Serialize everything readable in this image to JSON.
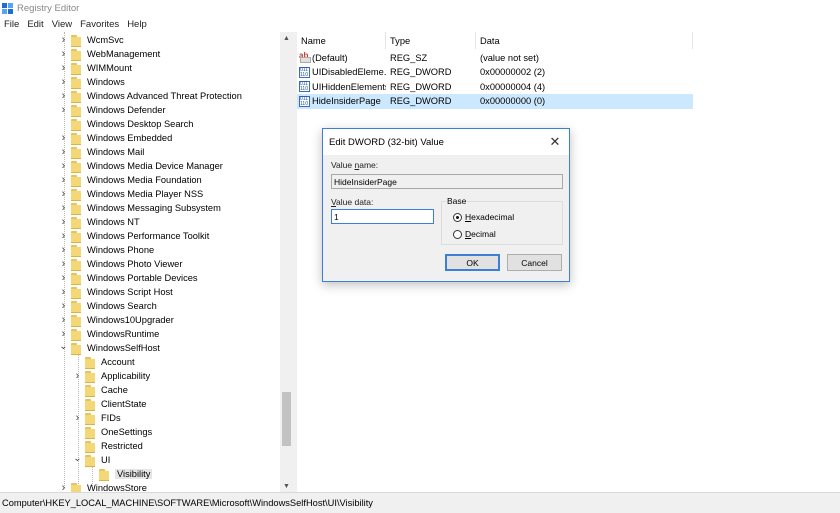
{
  "window": {
    "title": "Registry Editor",
    "icon": "registry-icon"
  },
  "menu": [
    "File",
    "Edit",
    "View",
    "Favorites",
    "Help"
  ],
  "tree": [
    {
      "label": "WcmSvc",
      "level": 0,
      "expander": "collapsed"
    },
    {
      "label": "WebManagement",
      "level": 0,
      "expander": "collapsed"
    },
    {
      "label": "WIMMount",
      "level": 0,
      "expander": "collapsed"
    },
    {
      "label": "Windows",
      "level": 0,
      "expander": "collapsed"
    },
    {
      "label": "Windows Advanced Threat Protection",
      "level": 0,
      "expander": "collapsed"
    },
    {
      "label": "Windows Defender",
      "level": 0,
      "expander": "collapsed"
    },
    {
      "label": "Windows Desktop Search",
      "level": 0,
      "expander": "none"
    },
    {
      "label": "Windows Embedded",
      "level": 0,
      "expander": "collapsed"
    },
    {
      "label": "Windows Mail",
      "level": 0,
      "expander": "collapsed"
    },
    {
      "label": "Windows Media Device Manager",
      "level": 0,
      "expander": "collapsed"
    },
    {
      "label": "Windows Media Foundation",
      "level": 0,
      "expander": "collapsed"
    },
    {
      "label": "Windows Media Player NSS",
      "level": 0,
      "expander": "collapsed"
    },
    {
      "label": "Windows Messaging Subsystem",
      "level": 0,
      "expander": "collapsed"
    },
    {
      "label": "Windows NT",
      "level": 0,
      "expander": "collapsed"
    },
    {
      "label": "Windows Performance Toolkit",
      "level": 0,
      "expander": "collapsed"
    },
    {
      "label": "Windows Phone",
      "level": 0,
      "expander": "collapsed"
    },
    {
      "label": "Windows Photo Viewer",
      "level": 0,
      "expander": "collapsed"
    },
    {
      "label": "Windows Portable Devices",
      "level": 0,
      "expander": "collapsed"
    },
    {
      "label": "Windows Script Host",
      "level": 0,
      "expander": "collapsed"
    },
    {
      "label": "Windows Search",
      "level": 0,
      "expander": "collapsed"
    },
    {
      "label": "Windows10Upgrader",
      "level": 0,
      "expander": "collapsed"
    },
    {
      "label": "WindowsRuntime",
      "level": 0,
      "expander": "collapsed"
    },
    {
      "label": "WindowsSelfHost",
      "level": 0,
      "expander": "expanded"
    },
    {
      "label": "Account",
      "level": 1,
      "expander": "none"
    },
    {
      "label": "Applicability",
      "level": 1,
      "expander": "collapsed"
    },
    {
      "label": "Cache",
      "level": 1,
      "expander": "none"
    },
    {
      "label": "ClientState",
      "level": 1,
      "expander": "none"
    },
    {
      "label": "FIDs",
      "level": 1,
      "expander": "collapsed"
    },
    {
      "label": "OneSettings",
      "level": 1,
      "expander": "none"
    },
    {
      "label": "Restricted",
      "level": 1,
      "expander": "none"
    },
    {
      "label": "UI",
      "level": 1,
      "expander": "expanded"
    },
    {
      "label": "Visibility",
      "level": 2,
      "expander": "none",
      "selected": true
    },
    {
      "label": "WindowsStore",
      "level": 0,
      "expander": "collapsed"
    }
  ],
  "list": {
    "columns": [
      "Name",
      "Type",
      "Data"
    ],
    "rows": [
      {
        "name": "(Default)",
        "type": "REG_SZ",
        "data": "(value not set)",
        "icon": "reg-sz-icon"
      },
      {
        "name": "UIDisabledEleme...",
        "type": "REG_DWORD",
        "data": "0x00000002 (2)",
        "icon": "reg-dword-icon"
      },
      {
        "name": "UIHiddenElements",
        "type": "REG_DWORD",
        "data": "0x00000004 (4)",
        "icon": "reg-dword-icon"
      },
      {
        "name": "HideInsiderPage",
        "type": "REG_DWORD",
        "data": "0x00000000 (0)",
        "icon": "reg-dword-icon",
        "selected": true
      }
    ]
  },
  "status_path": "Computer\\HKEY_LOCAL_MACHINE\\SOFTWARE\\Microsoft\\WindowsSelfHost\\UI\\Visibility",
  "dialog": {
    "title": "Edit DWORD (32-bit) Value",
    "value_name_label_pre": "Value ",
    "value_name_label_key": "n",
    "value_name_label_post": "ame:",
    "value_name": "HideInsiderPage",
    "value_data_label_key": "V",
    "value_data_label_post": "alue data:",
    "value_data": "1",
    "base_label": "Base",
    "hex_key": "H",
    "hex_post": "exadecimal",
    "dec_key": "D",
    "dec_post": "ecimal",
    "selected_base": "hexadecimal",
    "ok_label": "OK",
    "cancel_label": "Cancel"
  }
}
